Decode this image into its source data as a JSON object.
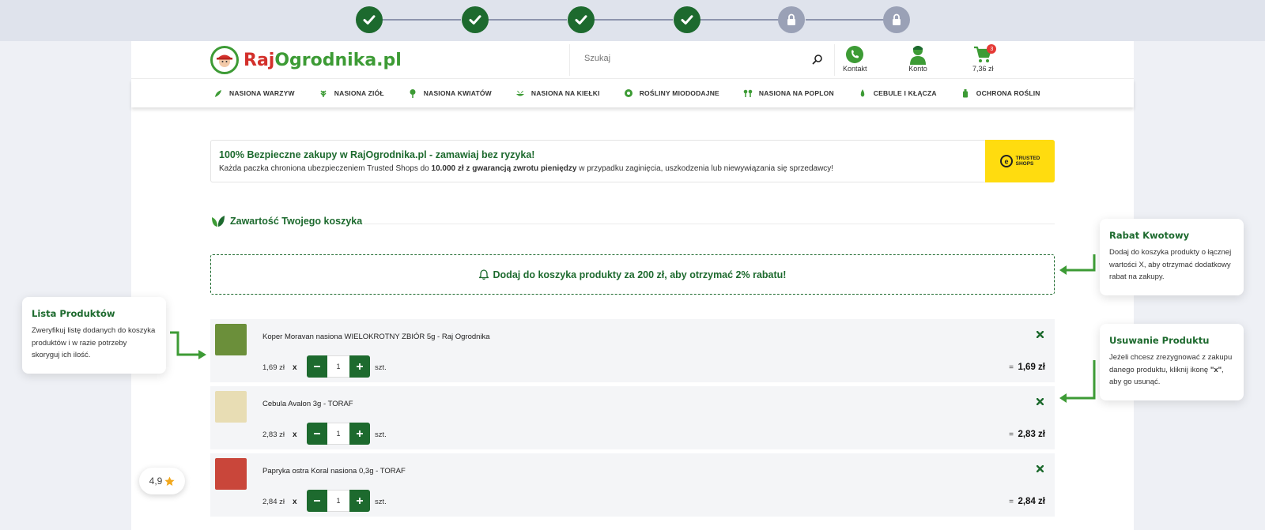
{
  "checkout_steps": [
    {
      "state": "done",
      "icon": "check-icon"
    },
    {
      "state": "done",
      "icon": "check-icon"
    },
    {
      "state": "done",
      "icon": "check-icon"
    },
    {
      "state": "done",
      "icon": "check-icon"
    },
    {
      "state": "locked",
      "icon": "lock-icon"
    },
    {
      "state": "locked",
      "icon": "lock-icon"
    }
  ],
  "header": {
    "logo_part1": "Raj",
    "logo_part2": "Ogrodnika.pl",
    "search_placeholder": "Szukaj",
    "contact_label": "Kontakt",
    "account_label": "Konto",
    "cart_total": "7,36 zł",
    "cart_count": "3"
  },
  "nav": {
    "items": [
      {
        "label": "NASIONA WARZYW",
        "icon": "pepper-icon"
      },
      {
        "label": "NASIONA ZIÓŁ",
        "icon": "herb-icon"
      },
      {
        "label": "NASIONA KWIATÓW",
        "icon": "flower-icon"
      },
      {
        "label": "NASIONA NA KIEŁKI",
        "icon": "sprout-icon"
      },
      {
        "label": "ROŚLINY MIODODAJNE",
        "icon": "honey-plant-icon"
      },
      {
        "label": "NASIONA NA POPLON",
        "icon": "plant-icon"
      },
      {
        "label": "CEBULE I KŁĄCZA",
        "icon": "bulb-icon"
      },
      {
        "label": "OCHRONA ROŚLIN",
        "icon": "bottle-icon"
      }
    ]
  },
  "trust_banner": {
    "title": "100% Bezpieczne zakupy w RajOgrodnika.pl - zamawiaj bez ryzyka!",
    "desc_before": "Każda paczka chroniona ubezpieczeniem Trusted Shops do ",
    "desc_bold": "10.000 zł z gwarancją zwrotu pieniędzy",
    "desc_after": " w przypadku zaginięcia, uszkodzenia lub niewywiązania się sprzedawcy!",
    "badge_text_1": "TRUSTED",
    "badge_text_2": "SHOPS"
  },
  "basket": {
    "heading": "Zawartość Twojego koszyka",
    "discount_message": "Dodaj do koszyka produkty za 200 zł, aby otrzymać 2% rabatu!",
    "x_label": "x",
    "unit_label": "szt.",
    "eq_label": "=",
    "products": [
      {
        "name": "Koper Moravan nasiona WIELOKROTNY ZBIÓR 5g - Raj Ogrodnika",
        "price": "1,69 zł",
        "quantity": "1",
        "total": "1,69 zł",
        "thumb_color": "#6b8f3a"
      },
      {
        "name": "Cebula Avalon 3g - TORAF",
        "price": "2,83 zł",
        "quantity": "1",
        "total": "2,83 zł",
        "thumb_color": "#e8ddb4"
      },
      {
        "name": "Papryka ostra Koral nasiona 0,3g - TORAF",
        "price": "2,84 zł",
        "quantity": "1",
        "total": "2,84 zł",
        "thumb_color": "#c9463a"
      }
    ]
  },
  "callouts": {
    "rabat": {
      "title": "Rabat Kwotowy",
      "text": "Dodaj do koszyka produkty o łącznej wartości X, aby otrzymać dodatkowy rabat na zakupy."
    },
    "lista": {
      "title": "Lista Produktów",
      "text": "Zweryfikuj listę dodanych do koszyka produktów i w razie potrzeby skoryguj ich ilość."
    },
    "usuwanie": {
      "title": "Usuwanie Produktu",
      "text_before": "Jeżeli chcesz zrezygnować z zakupu danego produktu, kliknij ikonę ",
      "text_bold": "\"x\"",
      "text_after": ", aby go usunąć."
    }
  },
  "rating": {
    "value": "4,9"
  },
  "colors": {
    "brand_green": "#1d6a2e",
    "accent_green": "#3d9b35",
    "logo_red": "#d3302b",
    "trusted_yellow": "#ffdc0f"
  }
}
